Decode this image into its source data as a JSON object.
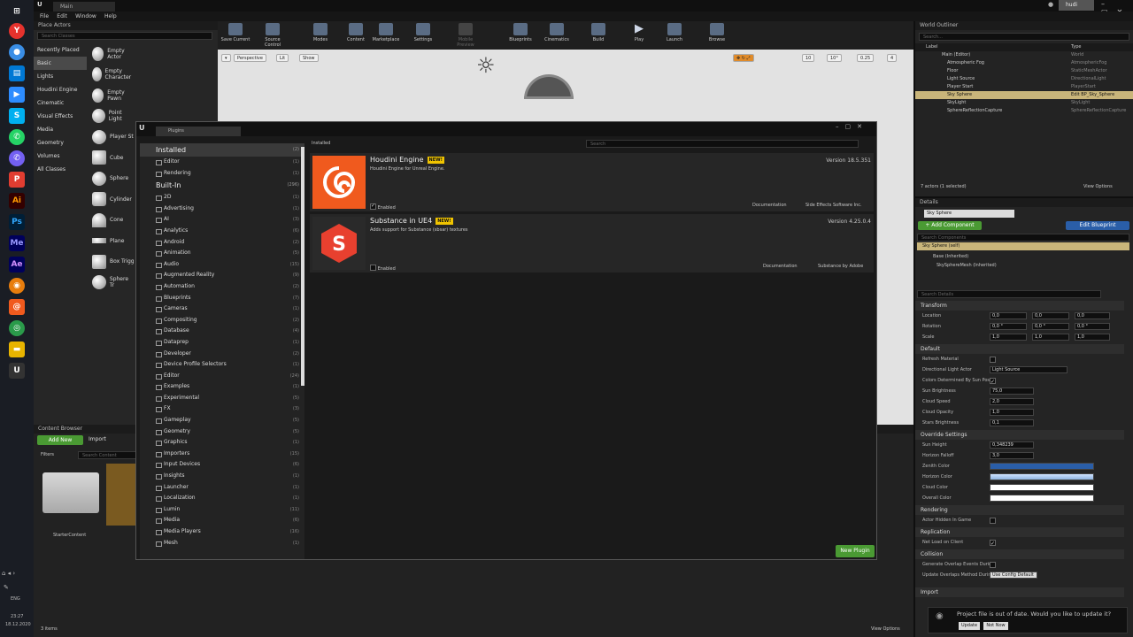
{
  "taskbar": {
    "lang": "ENG",
    "time": "23:27",
    "date": "18.12.2020"
  },
  "titlebar": {
    "tab": "Main",
    "user": "hudi"
  },
  "menu": [
    "File",
    "Edit",
    "Window",
    "Help"
  ],
  "place_actors": {
    "title": "Place Actors",
    "search_placeholder": "Search Classes",
    "categories": [
      "Recently Placed",
      "Basic",
      "Lights",
      "Houdini Engine",
      "Cinematic",
      "Visual Effects",
      "Media",
      "Geometry",
      "Volumes",
      "All Classes"
    ],
    "actors": [
      "Empty Actor",
      "Empty Character",
      "Empty Pawn",
      "Point Light",
      "Player St",
      "Cube",
      "Sphere",
      "Cylinder",
      "Cone",
      "Plane",
      "Box Trigg",
      "Sphere Tr"
    ]
  },
  "toolbar": [
    "Save Current",
    "Source Control",
    "Modes",
    "Content",
    "Marketplace",
    "Settings",
    "Mobile Preview",
    "Blueprints",
    "Cinematics",
    "Build",
    "Play",
    "Launch",
    "Browse"
  ],
  "viewport": {
    "perspective": "Perspective",
    "lit": "Lit",
    "show": "Show",
    "grid": "10",
    "angle": "10°",
    "scale": "0.25",
    "cams": "4"
  },
  "outliner": {
    "title": "World Outliner",
    "search_placeholder": "Search...",
    "col_label": "Label",
    "col_type": "Type",
    "rows": [
      {
        "l": "Main (Editor)",
        "t": "World"
      },
      {
        "l": "Atmospheric Fog",
        "t": "AtmosphericFog"
      },
      {
        "l": "Floor",
        "t": "StaticMeshActor"
      },
      {
        "l": "Light Source",
        "t": "DirectionalLight"
      },
      {
        "l": "Player Start",
        "t": "PlayerStart"
      },
      {
        "l": "Sky Sphere",
        "t": "Edit BP_Sky_Sphere"
      },
      {
        "l": "SkyLight",
        "t": "SkyLight"
      },
      {
        "l": "SphereReflectionCapture",
        "t": "SphereReflectionCapture"
      }
    ],
    "footer": "7 actors (1 selected)",
    "view_options": "View Options"
  },
  "details": {
    "title": "Details",
    "name": "Sky Sphere",
    "add_component": "+ Add Component",
    "edit_blueprint": "Edit Blueprint",
    "search_components": "Search Components",
    "self": "Sky Sphere (self)",
    "base": "Base (Inherited)",
    "mesh": "SkySphereMesh (Inherited)",
    "search_details": "Search Details",
    "transform": "Transform",
    "location": "Location",
    "rotation": "Rotation",
    "scale": "Scale",
    "loc": [
      "0,0",
      "0,0",
      "0,0"
    ],
    "rot": [
      "0,0 °",
      "0,0 °",
      "0,0 °"
    ],
    "scl": [
      "1,0",
      "1,0",
      "1,0"
    ],
    "default": "Default",
    "refresh": "Refresh Material",
    "dir_light": "Directional Light Actor",
    "dir_light_val": "Light Source",
    "color_det": "Colors Determined By Sun Positi",
    "sun_bright": "Sun Brightness",
    "sun_bright_v": "75,0",
    "cloud_speed": "Cloud Speed",
    "cloud_speed_v": "2,0",
    "cloud_opacity": "Cloud Opacity",
    "cloud_opacity_v": "1,0",
    "stars": "Stars Brightness",
    "stars_v": "0,1",
    "override": "Override Settings",
    "sun_height": "Sun Height",
    "sun_height_v": "0,348239",
    "horizon": "Horizon Falloff",
    "horizon_v": "3,0",
    "zenith": "Zenith Color",
    "horizon_color": "Horizon Color",
    "cloud_color": "Cloud Color",
    "overall": "Overall Color",
    "rendering": "Rendering",
    "actor_hidden": "Actor Hidden In Game",
    "replication": "Replication",
    "net_load": "Net Load on Client",
    "collision": "Collision",
    "overlap": "Generate Overlap Events During",
    "update_overlap": "Update Overlaps Method During",
    "use_config": "Use Config Default",
    "imp": "Import"
  },
  "content": {
    "title": "Content Browser",
    "add_new": "Add New",
    "import": "Import",
    "filters": "Filters",
    "search": "Search Content",
    "folder": "StarterContent",
    "items": "3 items",
    "view_options": "View Options"
  },
  "plugins": {
    "tab": "Plugins",
    "search_placeholder": "Search",
    "installed": "Installed",
    "installed_cnt": "(2)",
    "builtin": "Built-In",
    "builtin_cnt": "(296)",
    "installed_sub": [
      {
        "n": "Editor",
        "c": "(1)"
      },
      {
        "n": "Rendering",
        "c": "(1)"
      }
    ],
    "builtin_sub": [
      {
        "n": "2D",
        "c": "(1)"
      },
      {
        "n": "Advertising",
        "c": "(1)"
      },
      {
        "n": "AI",
        "c": "(3)"
      },
      {
        "n": "Analytics",
        "c": "(6)"
      },
      {
        "n": "Android",
        "c": "(2)"
      },
      {
        "n": "Animation",
        "c": "(5)"
      },
      {
        "n": "Audio",
        "c": "(15)"
      },
      {
        "n": "Augmented Reality",
        "c": "(9)"
      },
      {
        "n": "Automation",
        "c": "(2)"
      },
      {
        "n": "Blueprints",
        "c": "(7)"
      },
      {
        "n": "Cameras",
        "c": "(1)"
      },
      {
        "n": "Compositing",
        "c": "(2)"
      },
      {
        "n": "Database",
        "c": "(4)"
      },
      {
        "n": "Dataprep",
        "c": "(1)"
      },
      {
        "n": "Developer",
        "c": "(2)"
      },
      {
        "n": "Device Profile Selectors",
        "c": "(1)"
      },
      {
        "n": "Editor",
        "c": "(24)"
      },
      {
        "n": "Examples",
        "c": "(1)"
      },
      {
        "n": "Experimental",
        "c": "(5)"
      },
      {
        "n": "FX",
        "c": "(3)"
      },
      {
        "n": "Gameplay",
        "c": "(5)"
      },
      {
        "n": "Geometry",
        "c": "(5)"
      },
      {
        "n": "Graphics",
        "c": "(1)"
      },
      {
        "n": "Importers",
        "c": "(15)"
      },
      {
        "n": "Input Devices",
        "c": "(6)"
      },
      {
        "n": "Insights",
        "c": "(1)"
      },
      {
        "n": "Launcher",
        "c": "(1)"
      },
      {
        "n": "Localization",
        "c": "(1)"
      },
      {
        "n": "Lumin",
        "c": "(11)"
      },
      {
        "n": "Media",
        "c": "(6)"
      },
      {
        "n": "Media Players",
        "c": "(16)"
      },
      {
        "n": "Mesh",
        "c": "(1)"
      }
    ],
    "breadcrumb": "Installed",
    "cards": [
      {
        "name": "Houdini Engine",
        "desc": "Houdini Engine for Unreal Engine.",
        "version": "Version 18.5.351",
        "enabled": "Enabled",
        "doc": "Documentation",
        "vendor": "Side Effects Software Inc."
      },
      {
        "name": "Substance in UE4",
        "desc": "Adds support for Substance (sbsar) textures",
        "version": "Version 4.25.0.4",
        "enabled": "Enabled",
        "doc": "Documentation",
        "vendor": "Substance by Adobe"
      }
    ],
    "new_badge": "NEW!",
    "new_plugin": "New Plugin"
  },
  "notif": {
    "msg": "Project file is out of date. Would you like to update it?",
    "update": "Update",
    "not_now": "Not Now"
  },
  "colors": {
    "houdini": "#f05a1e",
    "substance": "#e8402f",
    "selection": "#c9b57a",
    "green": "#4a9a33",
    "blue": "#2a5ea8"
  }
}
